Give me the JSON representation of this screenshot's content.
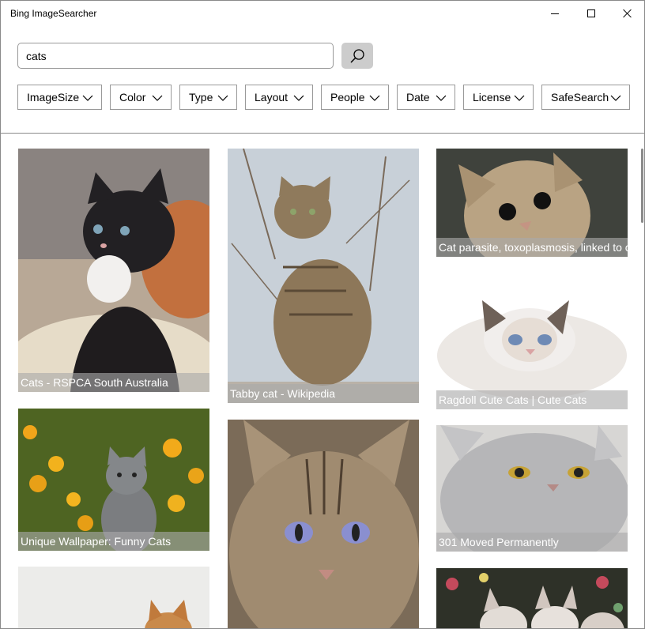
{
  "window": {
    "title": "Bing ImageSearcher"
  },
  "search": {
    "query": "cats",
    "button_icon": "search-icon"
  },
  "filters": [
    {
      "label": "ImageSize"
    },
    {
      "label": "Color"
    },
    {
      "label": "Type"
    },
    {
      "label": "Layout"
    },
    {
      "label": "People"
    },
    {
      "label": "Date"
    },
    {
      "label": "License"
    },
    {
      "label": "SafeSearch"
    }
  ],
  "results": [
    {
      "caption": "Cats - RSPCA South Australia",
      "depicts": "black-white-kitten"
    },
    {
      "caption": "Tabby cat - Wikipedia",
      "depicts": "sitting-tabby-cat"
    },
    {
      "caption": "Cat parasite, toxoplasmosis, linked to c",
      "depicts": "kitten-face"
    },
    {
      "caption": "Ragdoll Cute Cats | Cute Cats",
      "depicts": "ragdoll-kitten"
    },
    {
      "caption": "Unique Wallpaper: Funny Cats",
      "depicts": "grey-kitten-flowers"
    },
    {
      "caption": "",
      "depicts": "tabby-cat-face"
    },
    {
      "caption": "301 Moved Permanently",
      "depicts": "grey-persian-cat"
    },
    {
      "caption": "",
      "depicts": "orange-kitten"
    },
    {
      "caption": "",
      "depicts": "kittens-floral"
    }
  ],
  "colors": {
    "caption_overlay": "#aaaaaa",
    "search_button_bg": "#cccccc",
    "border": "#999999"
  }
}
